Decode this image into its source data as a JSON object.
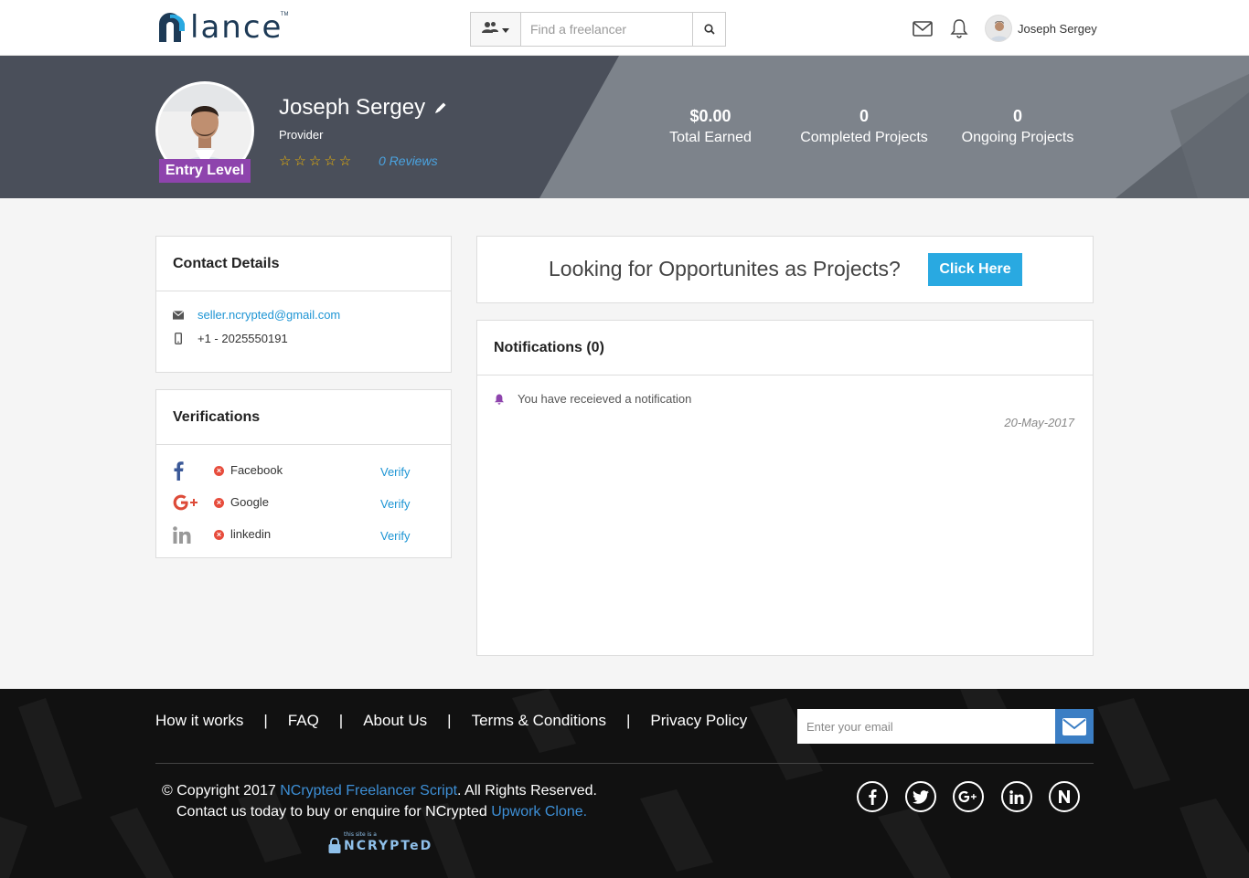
{
  "header": {
    "logo_text": "lance",
    "logo_tm": "TM",
    "search_placeholder": "Find a freelancer",
    "search_type_icon": "users-icon",
    "user_name": "Joseph Sergey"
  },
  "profile": {
    "name": "Joseph Sergey",
    "role": "Provider",
    "level": "Entry Level",
    "stars": "☆☆☆☆☆",
    "rating": 0,
    "reviews": "0 Reviews"
  },
  "stats": [
    {
      "value": "$0.00",
      "label": "Total Earned"
    },
    {
      "value": "0",
      "label": "Completed Projects"
    },
    {
      "value": "0",
      "label": "Ongoing Projects"
    }
  ],
  "contact": {
    "title": "Contact Details",
    "email": "seller.ncrypted@gmail.com",
    "phone": "+1 - 2025550191"
  },
  "verifications": {
    "title": "Verifications",
    "items": [
      {
        "name": "Facebook",
        "action": "Verify",
        "icon": "facebook-icon"
      },
      {
        "name": "Google",
        "action": "Verify",
        "icon": "google-plus-icon"
      },
      {
        "name": "linkedin",
        "action": "Verify",
        "icon": "linkedin-icon"
      }
    ]
  },
  "opportunities": {
    "text": "Looking for Opportunites as Projects?",
    "button": "Click Here"
  },
  "notifications": {
    "title": "Notifications (0)",
    "items": [
      {
        "text": "You have receieved a notification",
        "date": "20-May-2017"
      }
    ]
  },
  "footer": {
    "links": [
      "How it works",
      "FAQ",
      "About Us",
      "Terms & Conditions",
      "Privacy Policy"
    ],
    "email_placeholder": "Enter your email",
    "copy_prefix": "© Copyright 2017 ",
    "copy_link": "NCrypted Freelancer Script",
    "copy_suffix": ". All Rights Reserved.",
    "contact_prefix": "Contact us today to buy or enquire for NCrypted ",
    "contact_link": "Upwork Clone.",
    "badge_small": "this site is a",
    "badge_text": "NCRYPTeD",
    "social": [
      "facebook-icon",
      "twitter-icon",
      "google-plus-icon",
      "linkedin-icon",
      "ncrypted-icon"
    ]
  },
  "colors": {
    "accent": "#29a9e1",
    "level_badge": "#8e44ad",
    "banner_dark": "#4a4f5a",
    "banner_light": "#7d838b",
    "footer_bg": "#111111",
    "link": "#1e95d4"
  }
}
